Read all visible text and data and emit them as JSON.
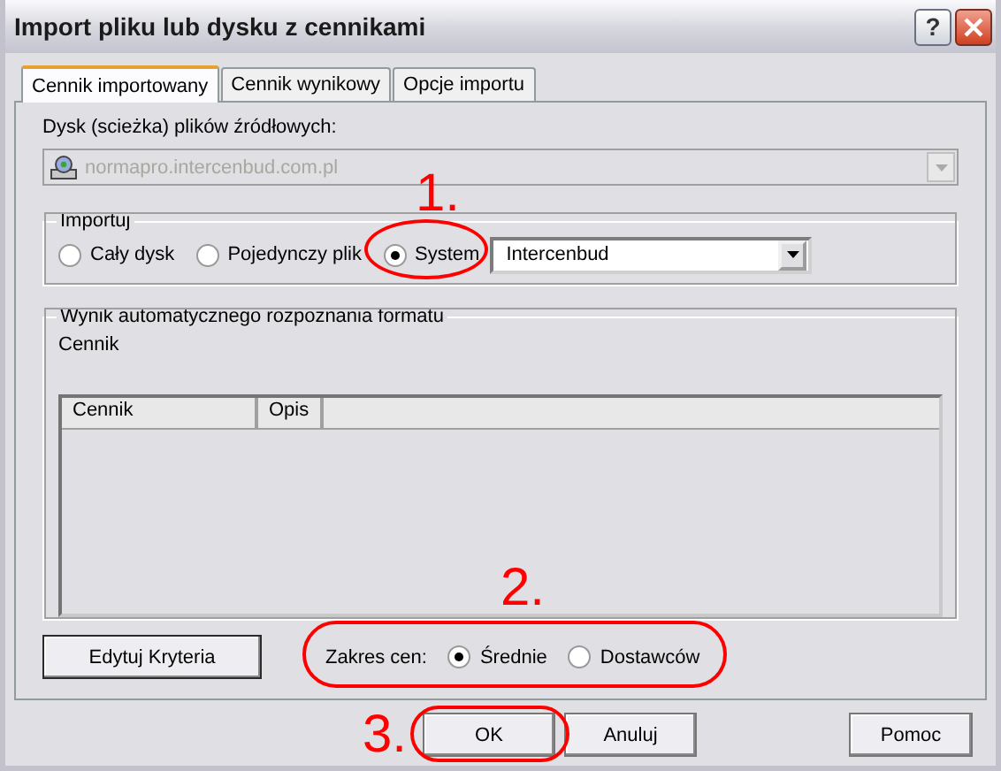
{
  "window": {
    "title": "Import pliku lub dysku z cennikami",
    "help_button": "?"
  },
  "tabs": [
    {
      "label": "Cennik importowany",
      "selected": true
    },
    {
      "label": "Cennik wynikowy",
      "selected": false
    },
    {
      "label": "Opcje importu",
      "selected": false
    }
  ],
  "source": {
    "label": "Dysk (scieżka) plików źródłowych:",
    "value": "normapro.intercenbud.com.pl",
    "disabled": true
  },
  "import_group": {
    "title": "Importuj",
    "options": [
      {
        "label": "Cały dysk",
        "selected": false
      },
      {
        "label": "Pojedynczy plik",
        "selected": false
      },
      {
        "label": "System",
        "selected": true
      }
    ],
    "system_combo": {
      "value": "Intercenbud"
    }
  },
  "result_group": {
    "title": "Wynik automatycznego rozpoznania formatu",
    "label": "Cennik",
    "table": {
      "columns": [
        "Cennik",
        "Opis"
      ]
    }
  },
  "criteria_button": "Edytuj Kryteria",
  "price_range": {
    "label": "Zakres cen:",
    "options": [
      {
        "label": "Średnie",
        "selected": true
      },
      {
        "label": "Dostawców",
        "selected": false
      }
    ]
  },
  "buttons": [
    {
      "label": "OK",
      "kind": "dialog"
    },
    {
      "label": "Anuluj",
      "kind": "dialog"
    },
    {
      "label": "Pomoc",
      "kind": "help"
    }
  ],
  "annotations": [
    {
      "label": "1."
    },
    {
      "label": "2."
    },
    {
      "label": "3."
    }
  ]
}
